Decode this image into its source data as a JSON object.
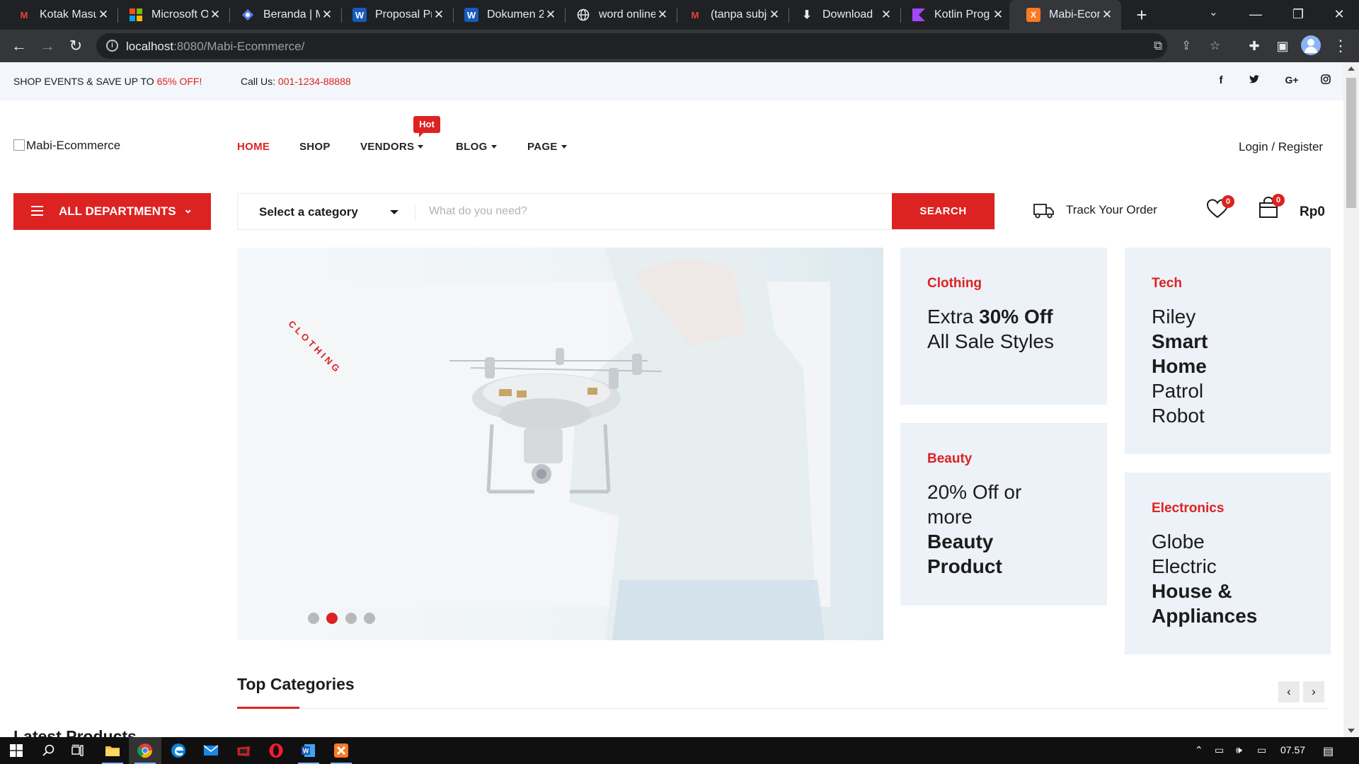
{
  "browser": {
    "tabs": [
      {
        "title": "Kotak Masuk",
        "icon": "gmail-icon"
      },
      {
        "title": "Microsoft Office",
        "icon": "microsoft-icon"
      },
      {
        "title": "Beranda | M",
        "icon": "app-icon"
      },
      {
        "title": "Proposal Pr",
        "icon": "word-icon"
      },
      {
        "title": "Dokumen 2",
        "icon": "word-icon"
      },
      {
        "title": "word online",
        "icon": "globe-icon"
      },
      {
        "title": "(tanpa subjek)",
        "icon": "gmail-icon"
      },
      {
        "title": "Download",
        "icon": "download-icon"
      },
      {
        "title": "Kotlin Prog",
        "icon": "kotlin-icon"
      },
      {
        "title": "Mabi-Ecom",
        "icon": "xampp-icon",
        "active": true
      }
    ],
    "url_host": "localhost",
    "url_path": ":8080/Mabi-Ecommerce/"
  },
  "topbar": {
    "promo_text": "SHOP EVENTS & SAVE UP TO ",
    "promo_highlight": "65% OFF!",
    "call_label": "Call Us: ",
    "call_number": "001-1234-88888",
    "social": [
      "f",
      "t",
      "G+",
      "ig"
    ]
  },
  "header": {
    "logo_alt": "Mabi-Ecommerce",
    "nav": [
      {
        "label": "HOME",
        "active": true
      },
      {
        "label": "SHOP"
      },
      {
        "label": "VENDORS",
        "dropdown": true,
        "badge": "Hot"
      },
      {
        "label": "BLOG",
        "dropdown": true
      },
      {
        "label": "PAGE",
        "dropdown": true
      }
    ],
    "login": "Login / Register"
  },
  "search": {
    "departments_label": "ALL DEPARTMENTS",
    "category_label": "Select a category",
    "placeholder": "What do you need?",
    "button_label": "SEARCH"
  },
  "actions": {
    "track_order": "Track Your Order",
    "wishlist_count": "0",
    "cart_count": "0",
    "cart_total": "Rp0"
  },
  "hero": {
    "vertical_tag": "CLOTHING",
    "slide_count": 4,
    "active_slide": 2
  },
  "promo_cards": [
    {
      "category": "Clothing",
      "pre": "Extra ",
      "bold": "30% Off",
      "post": " All Sale Styles"
    },
    {
      "category": "Tech",
      "pre": "Riley ",
      "bold": "Smart Home",
      "post": " Patrol Robot"
    },
    {
      "category": "Beauty",
      "pre": "20% Off or more ",
      "bold": "Beauty Product",
      "post": ""
    },
    {
      "category": "Electronics",
      "pre": "Globe Electric ",
      "bold": "House & Appliances",
      "post": ""
    }
  ],
  "sections": {
    "top_categories": "Top Categories",
    "latest_products": "Latest Products",
    "prev": "‹",
    "next": "›"
  },
  "taskbar": {
    "time": "07.57"
  },
  "colors": {
    "accent": "#dd2222",
    "card_bg": "#edf1f8",
    "topbar_bg": "#f3f6fa"
  }
}
